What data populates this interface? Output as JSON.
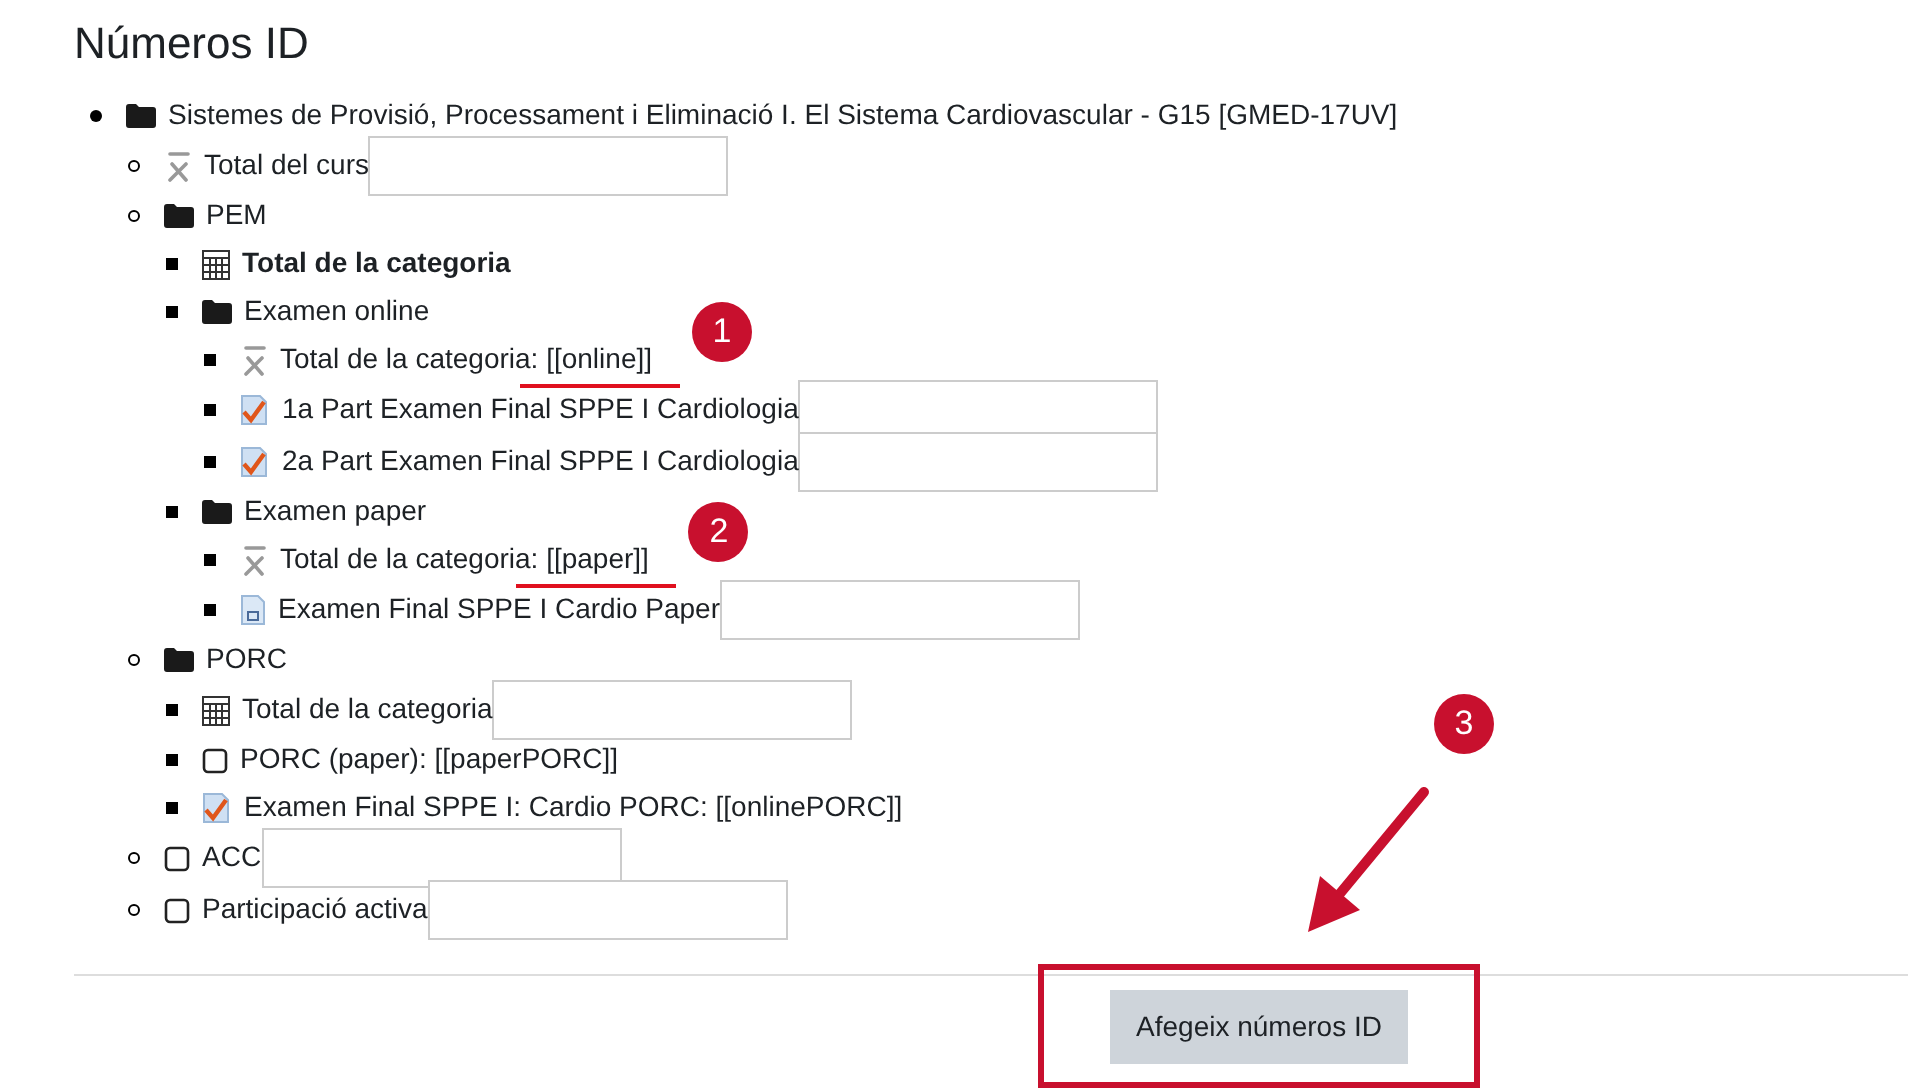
{
  "title": "Números ID",
  "tree": [
    {
      "kind": "folder",
      "label": "Sistemes de Provisió, Processament i Eliminació I. El Sistema Cardiovascular - G15 [GMED-17UV]",
      "input": false,
      "children": [
        {
          "kind": "mean",
          "label": "Total del curs",
          "input": true
        },
        {
          "kind": "folder",
          "label": "PEM",
          "input": false,
          "children": [
            {
              "kind": "calc",
              "label": "Total de la categoria",
              "input": false,
              "bold": true
            },
            {
              "kind": "folder",
              "label": "Examen online",
              "input": false,
              "children": [
                {
                  "kind": "mean",
                  "label": "Total de la categoria: [[online]]",
                  "input": false,
                  "marker": "1"
                },
                {
                  "kind": "quiz",
                  "label": "1a Part Examen Final SPPE I Cardiologia",
                  "input": true
                },
                {
                  "kind": "quiz",
                  "label": "2a Part Examen Final SPPE I Cardiologia",
                  "input": true
                }
              ]
            },
            {
              "kind": "folder",
              "label": "Examen paper",
              "input": false,
              "children": [
                {
                  "kind": "mean",
                  "label": "Total de la categoria: [[paper]]",
                  "input": false,
                  "marker": "2"
                },
                {
                  "kind": "assign",
                  "label": "Examen Final SPPE I Cardio Paper",
                  "input": true
                }
              ]
            }
          ]
        },
        {
          "kind": "folder",
          "label": "PORC",
          "input": false,
          "children": [
            {
              "kind": "calc",
              "label": "Total de la categoria",
              "input": true
            },
            {
              "kind": "empty",
              "label": "PORC (paper): [[paperPORC]]",
              "input": false
            },
            {
              "kind": "quiz",
              "label": "Examen Final SPPE I: Cardio PORC: [[onlinePORC]]",
              "input": false
            }
          ]
        },
        {
          "kind": "empty",
          "label": "ACC",
          "input": true
        },
        {
          "kind": "empty",
          "label": "Participació activa",
          "input": true
        }
      ]
    }
  ],
  "footer": {
    "button": "Afegeix números ID",
    "marker": "3"
  }
}
